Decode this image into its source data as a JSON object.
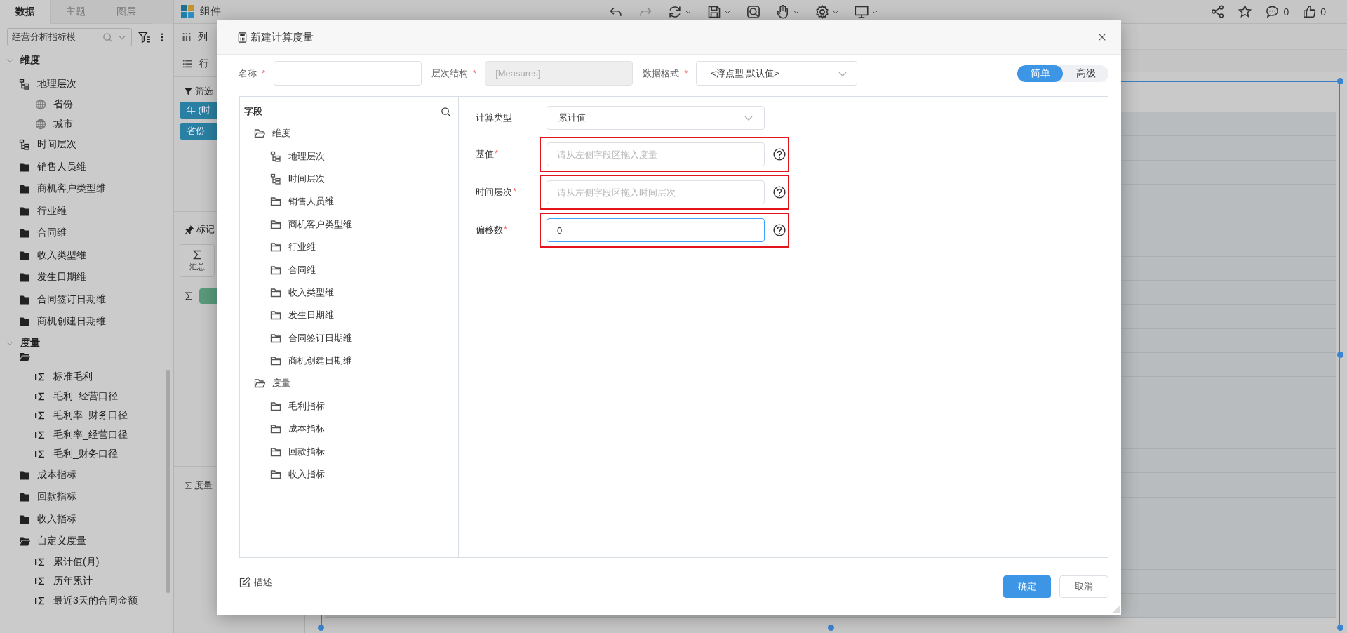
{
  "sidebar": {
    "tabs": [
      {
        "label": "数据",
        "selected": true
      },
      {
        "label": "主题",
        "selected": false
      },
      {
        "label": "图层",
        "selected": false
      }
    ],
    "model_select": {
      "value": "经营分析指标模"
    },
    "tree": [
      {
        "label": "维度",
        "kind": "section",
        "expanded": true,
        "children": [
          {
            "label": "地理层次",
            "kind": "hierarchy",
            "children": [
              {
                "label": "省份",
                "kind": "level"
              },
              {
                "label": "城市",
                "kind": "level"
              }
            ]
          },
          {
            "label": "时间层次",
            "kind": "hierarchy"
          },
          {
            "label": "销售人员维",
            "kind": "folder",
            "expanded": false
          },
          {
            "label": "商机客户类型维",
            "kind": "folder",
            "expanded": false
          },
          {
            "label": "行业维",
            "kind": "folder",
            "expanded": false
          },
          {
            "label": "合同维",
            "kind": "folder",
            "expanded": false
          },
          {
            "label": "收入类型维",
            "kind": "folder",
            "expanded": false
          },
          {
            "label": "发生日期维",
            "kind": "folder",
            "expanded": false
          },
          {
            "label": "合同签订日期维",
            "kind": "folder",
            "expanded": false
          },
          {
            "label": "商机创建日期维",
            "kind": "folder",
            "expanded": false
          }
        ]
      },
      {
        "label": "度量",
        "kind": "section",
        "expanded": true,
        "children": [
          {
            "kind": "folder",
            "expanded": true,
            "children": [
              {
                "label": "标准毛利",
                "kind": "measure"
              },
              {
                "label": "毛利_经营口径",
                "kind": "measure"
              },
              {
                "label": "毛利率_财务口径",
                "kind": "measure"
              },
              {
                "label": "毛利率_经营口径",
                "kind": "measure"
              },
              {
                "label": "毛利_财务口径",
                "kind": "measure"
              }
            ]
          },
          {
            "label": "成本指标",
            "kind": "folder",
            "expanded": false
          },
          {
            "label": "回款指标",
            "kind": "folder",
            "expanded": false
          },
          {
            "label": "收入指标",
            "kind": "folder",
            "expanded": false
          },
          {
            "label": "自定义度量",
            "kind": "folder",
            "expanded": true,
            "children": [
              {
                "label": "累计值(月)",
                "kind": "measure"
              },
              {
                "label": "历年累计",
                "kind": "measure"
              },
              {
                "label": "最近3天的合同金额",
                "kind": "measure"
              }
            ]
          }
        ]
      }
    ]
  },
  "topbar": {
    "title": "组件",
    "counters": [
      {
        "kind": "comment",
        "count": "0"
      },
      {
        "kind": "like",
        "count": "0"
      }
    ]
  },
  "shelves": {
    "columns": {
      "label": "列"
    },
    "rows": {
      "label": "行"
    },
    "filter": {
      "label": "筛选",
      "pills": [
        "年 (时",
        "省份"
      ]
    },
    "marks": {
      "label": "标记",
      "button": "汇总"
    },
    "measure_values": {
      "label": "度量"
    }
  },
  "dialog": {
    "title": "新建计算度量",
    "header_fields": [
      {
        "kind": "text",
        "label": "名称",
        "asterisk": "*",
        "disabled": false
      },
      {
        "kind": "text",
        "label": "层次结构",
        "asterisk": "*",
        "value": "[Measures]",
        "disabled": true
      },
      {
        "kind": "select",
        "label": "数据格式",
        "asterisk": "*",
        "value": "<浮点型-默认值>",
        "disabled": false
      }
    ],
    "mode": [
      {
        "label": "简单",
        "selected": true
      },
      {
        "label": "高级",
        "selected": false
      }
    ],
    "field_tree": {
      "title": "字段",
      "items": [
        {
          "label": "维度",
          "kind": "folder",
          "expanded": true,
          "children": [
            {
              "label": "地理层次",
              "kind": "hierarchy"
            },
            {
              "label": "时间层次",
              "kind": "hierarchy"
            },
            {
              "label": "销售人员维",
              "kind": "folder",
              "expanded": false
            },
            {
              "label": "商机客户类型维",
              "kind": "folder",
              "expanded": false
            },
            {
              "label": "行业维",
              "kind": "folder",
              "expanded": false
            },
            {
              "label": "合同维",
              "kind": "folder",
              "expanded": false
            },
            {
              "label": "收入类型维",
              "kind": "folder",
              "expanded": false
            },
            {
              "label": "发生日期维",
              "kind": "folder",
              "expanded": false
            },
            {
              "label": "合同签订日期维",
              "kind": "folder",
              "expanded": false
            },
            {
              "label": "商机创建日期维",
              "kind": "folder",
              "expanded": false
            }
          ]
        },
        {
          "label": "度量",
          "kind": "folder",
          "expanded": true,
          "children": [
            {
              "label": "毛利指标",
              "kind": "folder",
              "expanded": false
            },
            {
              "label": "成本指标",
              "kind": "folder",
              "expanded": false
            },
            {
              "label": "回款指标",
              "kind": "folder",
              "expanded": false
            },
            {
              "label": "收入指标",
              "kind": "folder",
              "expanded": false
            }
          ]
        }
      ]
    },
    "calc_type": {
      "label": "计算类型",
      "value": "累计值"
    },
    "params": [
      {
        "label": "基值",
        "asterisk": "*",
        "placeholder": "请从左侧字段区拖入度量",
        "focused": false,
        "highlighted": true
      },
      {
        "label": "时间层次",
        "asterisk": "*",
        "placeholder": "请从左侧字段区拖入时间层次",
        "focused": false,
        "highlighted": true
      },
      {
        "label": "偏移数",
        "asterisk": "*",
        "value": "0",
        "focused": true,
        "highlighted": true
      }
    ],
    "describe": "描述",
    "buttons": [
      {
        "label": "确定",
        "kind": "primary"
      },
      {
        "label": "取消",
        "kind": "secondary"
      }
    ]
  }
}
